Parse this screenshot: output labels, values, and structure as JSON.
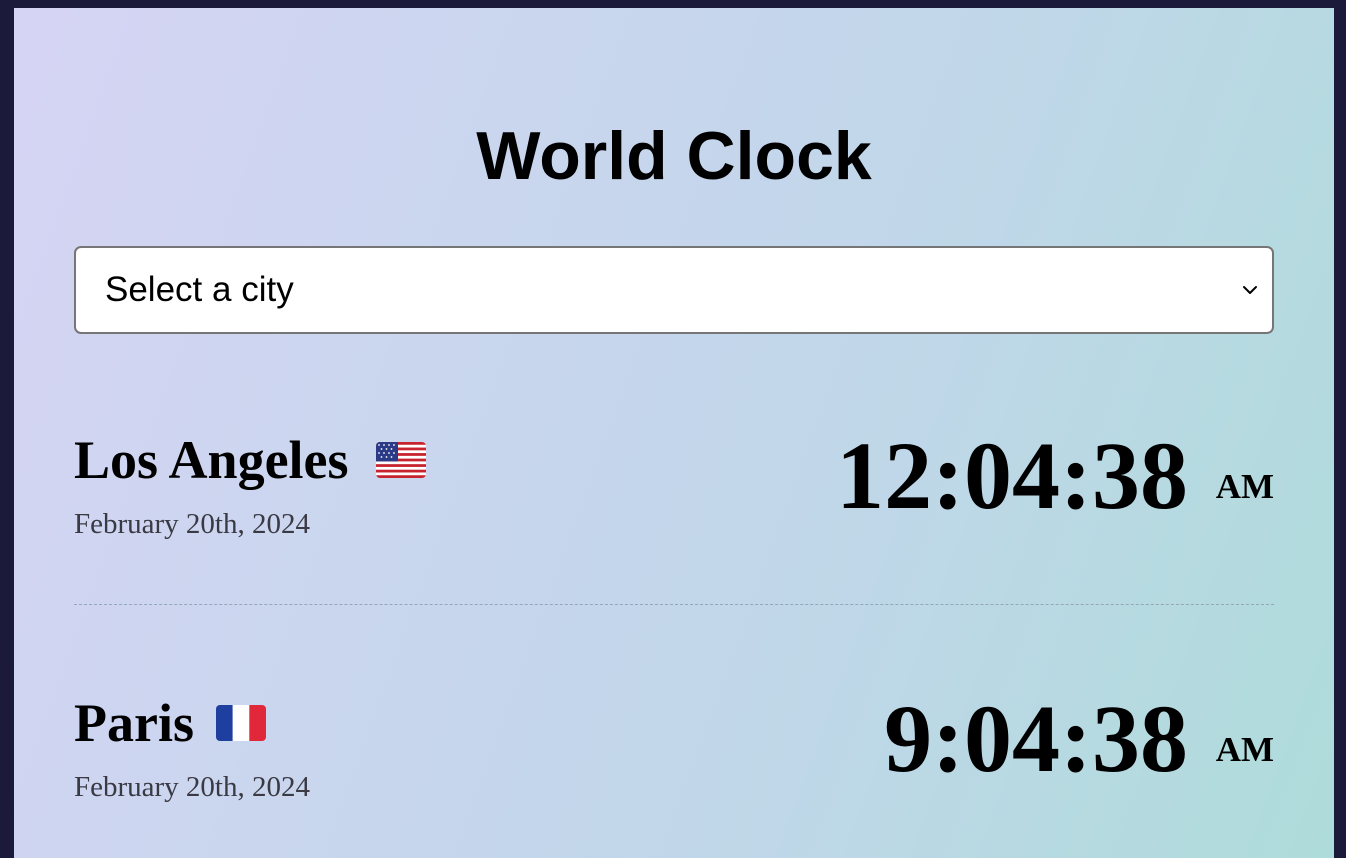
{
  "app": {
    "title": "World Clock"
  },
  "city_select": {
    "selected_label": "Select a city"
  },
  "cities": [
    {
      "name": "Los Angeles",
      "flag_icon": "us-flag-icon",
      "date": "February 20th, 2024",
      "time": "12:04:38",
      "period": "AM"
    },
    {
      "name": "Paris",
      "flag_icon": "fr-flag-icon",
      "date": "February 20th, 2024",
      "time": "9:04:38",
      "period": "AM"
    }
  ],
  "colors": {
    "page_background": "#1b1a3a",
    "gradient_start": "#d6d4f4",
    "gradient_end": "#aedcda",
    "divider": "#93a7b8",
    "date_text": "#3a3a44"
  }
}
